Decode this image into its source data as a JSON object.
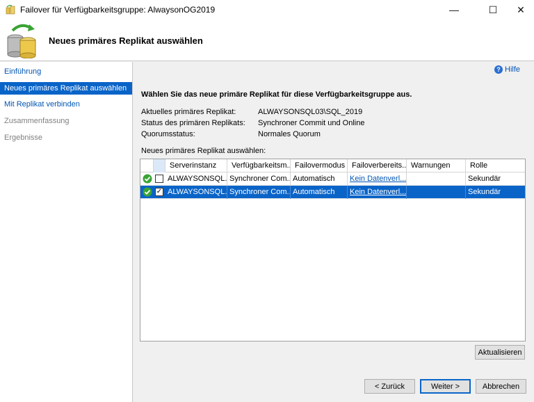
{
  "window": {
    "title": "Failover für Verfügbarkeitsgruppe: AlwaysonOG2019",
    "minimize": "—",
    "maximize": "☐",
    "close": "✕"
  },
  "header": {
    "title": "Neues primäres Replikat auswählen"
  },
  "sidebar": {
    "items": [
      {
        "label": "Einführung",
        "state": "link"
      },
      {
        "label": "Neues primäres Replikat auswählen",
        "state": "active"
      },
      {
        "label": "Mit Replikat verbinden",
        "state": "link"
      },
      {
        "label": "Zusammenfassung",
        "state": "disabled"
      },
      {
        "label": "Ergebnisse",
        "state": "disabled"
      }
    ]
  },
  "help": {
    "label": "Hilfe",
    "glyph": "?"
  },
  "main": {
    "instruction": "Wählen Sie das neue primäre Replikat für diese Verfügbarkeitsgruppe aus.",
    "info": [
      {
        "label": "Aktuelles primäres Replikat:",
        "value": "ALWAYSONSQL03\\SQL_2019"
      },
      {
        "label": "Status des primären Replikats:",
        "value": "Synchroner Commit und Online"
      },
      {
        "label": "Quorumsstatus:",
        "value": "Normales Quorum"
      }
    ],
    "select_label": "Neues primäres Replikat auswählen:"
  },
  "grid": {
    "columns": [
      "Serverinstanz",
      "Verfügbarkeitsm...",
      "Failovermodus",
      "Failoverbereits...",
      "Warnungen",
      "Rolle"
    ],
    "rows": [
      {
        "server": "ALWAYSONSQL...",
        "mode": "Synchroner Com...",
        "failover": "Automatisch",
        "readiness": "Kein Datenverl...",
        "warnings": "",
        "role": "Sekundär",
        "checked": "",
        "selected": false
      },
      {
        "server": "ALWAYSONSQL...",
        "mode": "Synchroner Com...",
        "failover": "Automatisch",
        "readiness": "Kein Datenverl...",
        "warnings": "",
        "role": "Sekundär",
        "checked": "✓",
        "selected": true
      }
    ]
  },
  "buttons": {
    "refresh": "Aktualisieren",
    "back": "< Zurück",
    "next": "Weiter >",
    "cancel": "Abbrechen"
  },
  "colors": {
    "accent": "#0a64c8",
    "link": "#0055b3",
    "success": "#3aa335"
  }
}
